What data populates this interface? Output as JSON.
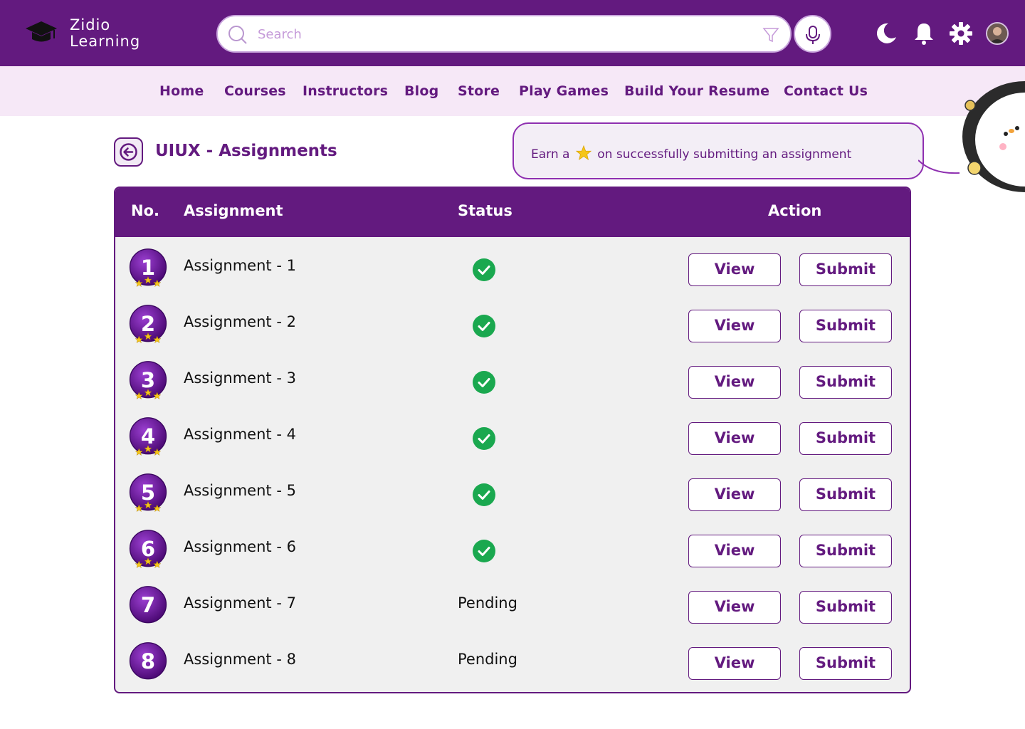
{
  "app": {
    "logo_line1": "Zidio",
    "logo_line2": "Learning"
  },
  "search": {
    "placeholder": "Search"
  },
  "nav": [
    {
      "label": "Home"
    },
    {
      "label": "Courses"
    },
    {
      "label": "Instructors"
    },
    {
      "label": "Blog"
    },
    {
      "label": "Store"
    },
    {
      "label": "Play Games"
    },
    {
      "label": "Build Your Resume"
    },
    {
      "label": "Contact Us"
    }
  ],
  "page": {
    "title": "UIUX - Assignments"
  },
  "banner": {
    "text_before": "Earn a",
    "icon": "star-icon",
    "text_after": "on successfully submitting an assignment"
  },
  "table": {
    "headers": {
      "no": "No.",
      "assignment": "Assignment",
      "status": "Status",
      "action": "Action"
    },
    "rows": [
      {
        "no": "1",
        "name": "Assignment - 1",
        "status": "done",
        "status_text": "",
        "stars": 3,
        "view": "View",
        "submit": "Submit"
      },
      {
        "no": "2",
        "name": "Assignment - 2",
        "status": "done",
        "status_text": "",
        "stars": 3,
        "view": "View",
        "submit": "Submit"
      },
      {
        "no": "3",
        "name": "Assignment - 3",
        "status": "done",
        "status_text": "",
        "stars": 3,
        "view": "View",
        "submit": "Submit"
      },
      {
        "no": "4",
        "name": "Assignment - 4",
        "status": "done",
        "status_text": "",
        "stars": 3,
        "view": "View",
        "submit": "Submit"
      },
      {
        "no": "5",
        "name": "Assignment - 5",
        "status": "done",
        "status_text": "",
        "stars": 3,
        "view": "View",
        "submit": "Submit"
      },
      {
        "no": "6",
        "name": "Assignment - 6",
        "status": "done",
        "status_text": "",
        "stars": 3,
        "view": "View",
        "submit": "Submit"
      },
      {
        "no": "7",
        "name": "Assignment - 7",
        "status": "pending",
        "status_text": "Pending",
        "stars": 0,
        "view": "View",
        "submit": "Submit"
      },
      {
        "no": "8",
        "name": "Assignment - 8",
        "status": "pending",
        "status_text": "Pending",
        "stars": 0,
        "view": "View",
        "submit": "Submit"
      }
    ]
  },
  "colors": {
    "brand": "#631a7f",
    "nav_bg": "#f6e8f7",
    "success": "#1aa84f",
    "star": "#f5c518"
  }
}
